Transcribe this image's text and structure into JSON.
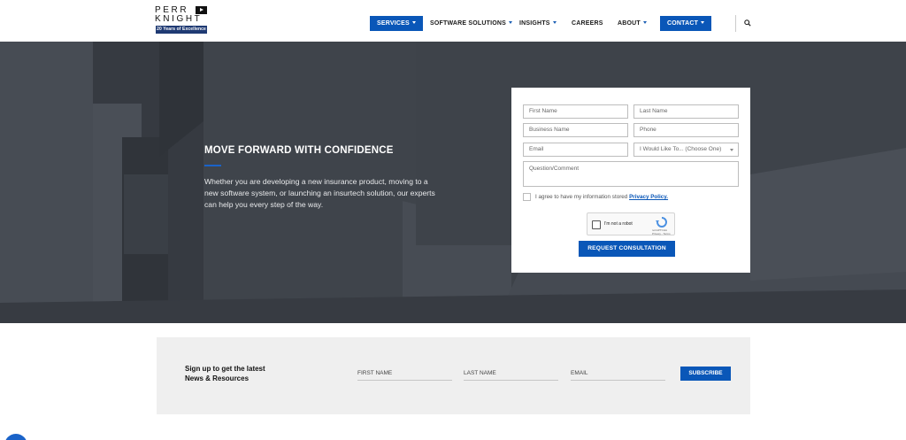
{
  "header": {
    "logo": {
      "line1": "PERR",
      "line2": "KNIGHT",
      "badge": "20 Years of Excellence"
    },
    "nav": [
      {
        "label": "SERVICES",
        "dropdown": true,
        "highlight": true
      },
      {
        "label": "SOFTWARE SOLUTIONS",
        "dropdown": true
      },
      {
        "label": "INSIGHTS",
        "dropdown": true
      },
      {
        "label": "CAREERS",
        "dropdown": false
      },
      {
        "label": "ABOUT",
        "dropdown": true
      },
      {
        "label": "CONTACT",
        "dropdown": true,
        "highlight": true
      }
    ],
    "search_icon": "search-icon"
  },
  "hero": {
    "title": "MOVE FORWARD WITH CONFIDENCE",
    "text": "Whether you are developing a new insurance product, moving to a new software system, or launching an insurtech solution, our experts can help you every step of the way."
  },
  "form": {
    "first_name": "First Name",
    "last_name": "Last Name",
    "business_name": "Business Name",
    "phone": "Phone",
    "email": "Email",
    "interest_select": "I Would Like To... (Choose One)",
    "question": "Question/Comment",
    "consent_text": "I agree to have my information stored",
    "privacy_link": "Privacy Policy.",
    "captcha_label": "I'm not a robot",
    "captcha_brand": "reCAPTCHA",
    "captcha_terms": "Privacy - Terms",
    "submit": "REQUEST CONSULTATION"
  },
  "newsletter": {
    "heading_line1": "Sign up to get the latest",
    "heading_line2": "News & Resources",
    "first_name": "FIRST NAME",
    "last_name": "LAST NAME",
    "email": "EMAIL",
    "subscribe": "SUBSCRIBE"
  },
  "colors": {
    "brand_blue": "#0a57b8",
    "hero_bg": "#3b4048",
    "newsletter_bg": "#efefef"
  }
}
